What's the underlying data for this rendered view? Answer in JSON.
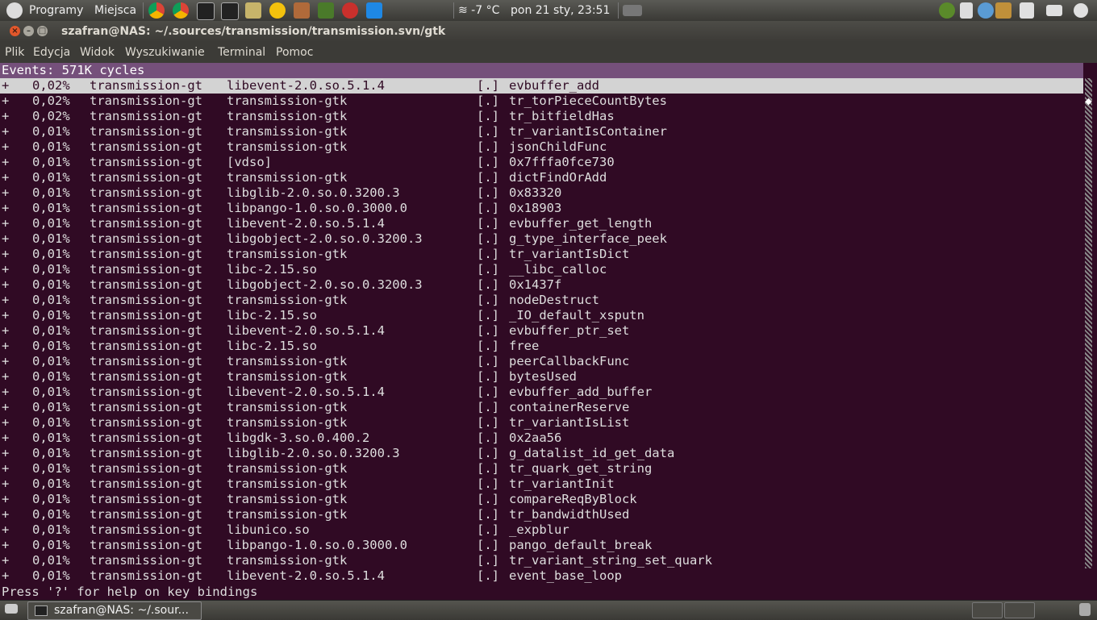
{
  "top_panel": {
    "apps_label": "Programy",
    "places_label": "Miejsca",
    "weather": "≋ -7 °C",
    "clock": "pon 21 sty, 23:51"
  },
  "window": {
    "title": "szafran@NAS: ~/.sources/transmission/transmission.svn/gtk"
  },
  "menu": [
    "Plik",
    "Edycja",
    "Widok",
    "Wyszukiwanie",
    "Terminal",
    "Pomoc"
  ],
  "terminal": {
    "events_header": "Events: 571K cycles",
    "rows": [
      {
        "mark": "+",
        "pct": "0,02%",
        "cmd": "transmission-gt",
        "obj": "libevent-2.0.so.5.1.4",
        "lvl": "[.]",
        "sym": "evbuffer_add"
      },
      {
        "mark": "+",
        "pct": "0,02%",
        "cmd": "transmission-gt",
        "obj": "transmission-gtk",
        "lvl": "[.]",
        "sym": "tr_torPieceCountBytes"
      },
      {
        "mark": "+",
        "pct": "0,02%",
        "cmd": "transmission-gt",
        "obj": "transmission-gtk",
        "lvl": "[.]",
        "sym": "tr_bitfieldHas"
      },
      {
        "mark": "+",
        "pct": "0,01%",
        "cmd": "transmission-gt",
        "obj": "transmission-gtk",
        "lvl": "[.]",
        "sym": "tr_variantIsContainer"
      },
      {
        "mark": "+",
        "pct": "0,01%",
        "cmd": "transmission-gt",
        "obj": "transmission-gtk",
        "lvl": "[.]",
        "sym": "jsonChildFunc"
      },
      {
        "mark": "+",
        "pct": "0,01%",
        "cmd": "transmission-gt",
        "obj": "[vdso]",
        "lvl": "[.]",
        "sym": "0x7fffa0fce730"
      },
      {
        "mark": "+",
        "pct": "0,01%",
        "cmd": "transmission-gt",
        "obj": "transmission-gtk",
        "lvl": "[.]",
        "sym": "dictFindOrAdd"
      },
      {
        "mark": "+",
        "pct": "0,01%",
        "cmd": "transmission-gt",
        "obj": "libglib-2.0.so.0.3200.3",
        "lvl": "[.]",
        "sym": "0x83320"
      },
      {
        "mark": "+",
        "pct": "0,01%",
        "cmd": "transmission-gt",
        "obj": "libpango-1.0.so.0.3000.0",
        "lvl": "[.]",
        "sym": "0x18903"
      },
      {
        "mark": "+",
        "pct": "0,01%",
        "cmd": "transmission-gt",
        "obj": "libevent-2.0.so.5.1.4",
        "lvl": "[.]",
        "sym": "evbuffer_get_length"
      },
      {
        "mark": "+",
        "pct": "0,01%",
        "cmd": "transmission-gt",
        "obj": "libgobject-2.0.so.0.3200.3",
        "lvl": "[.]",
        "sym": "g_type_interface_peek"
      },
      {
        "mark": "+",
        "pct": "0,01%",
        "cmd": "transmission-gt",
        "obj": "transmission-gtk",
        "lvl": "[.]",
        "sym": "tr_variantIsDict"
      },
      {
        "mark": "+",
        "pct": "0,01%",
        "cmd": "transmission-gt",
        "obj": "libc-2.15.so",
        "lvl": "[.]",
        "sym": "__libc_calloc"
      },
      {
        "mark": "+",
        "pct": "0,01%",
        "cmd": "transmission-gt",
        "obj": "libgobject-2.0.so.0.3200.3",
        "lvl": "[.]",
        "sym": "0x1437f"
      },
      {
        "mark": "+",
        "pct": "0,01%",
        "cmd": "transmission-gt",
        "obj": "transmission-gtk",
        "lvl": "[.]",
        "sym": "nodeDestruct"
      },
      {
        "mark": "+",
        "pct": "0,01%",
        "cmd": "transmission-gt",
        "obj": "libc-2.15.so",
        "lvl": "[.]",
        "sym": "_IO_default_xsputn"
      },
      {
        "mark": "+",
        "pct": "0,01%",
        "cmd": "transmission-gt",
        "obj": "libevent-2.0.so.5.1.4",
        "lvl": "[.]",
        "sym": "evbuffer_ptr_set"
      },
      {
        "mark": "+",
        "pct": "0,01%",
        "cmd": "transmission-gt",
        "obj": "libc-2.15.so",
        "lvl": "[.]",
        "sym": "free"
      },
      {
        "mark": "+",
        "pct": "0,01%",
        "cmd": "transmission-gt",
        "obj": "transmission-gtk",
        "lvl": "[.]",
        "sym": "peerCallbackFunc"
      },
      {
        "mark": "+",
        "pct": "0,01%",
        "cmd": "transmission-gt",
        "obj": "transmission-gtk",
        "lvl": "[.]",
        "sym": "bytesUsed"
      },
      {
        "mark": "+",
        "pct": "0,01%",
        "cmd": "transmission-gt",
        "obj": "libevent-2.0.so.5.1.4",
        "lvl": "[.]",
        "sym": "evbuffer_add_buffer"
      },
      {
        "mark": "+",
        "pct": "0,01%",
        "cmd": "transmission-gt",
        "obj": "transmission-gtk",
        "lvl": "[.]",
        "sym": "containerReserve"
      },
      {
        "mark": "+",
        "pct": "0,01%",
        "cmd": "transmission-gt",
        "obj": "transmission-gtk",
        "lvl": "[.]",
        "sym": "tr_variantIsList"
      },
      {
        "mark": "+",
        "pct": "0,01%",
        "cmd": "transmission-gt",
        "obj": "libgdk-3.so.0.400.2",
        "lvl": "[.]",
        "sym": "0x2aa56"
      },
      {
        "mark": "+",
        "pct": "0,01%",
        "cmd": "transmission-gt",
        "obj": "libglib-2.0.so.0.3200.3",
        "lvl": "[.]",
        "sym": "g_datalist_id_get_data"
      },
      {
        "mark": "+",
        "pct": "0,01%",
        "cmd": "transmission-gt",
        "obj": "transmission-gtk",
        "lvl": "[.]",
        "sym": "tr_quark_get_string"
      },
      {
        "mark": "+",
        "pct": "0,01%",
        "cmd": "transmission-gt",
        "obj": "transmission-gtk",
        "lvl": "[.]",
        "sym": "tr_variantInit"
      },
      {
        "mark": "+",
        "pct": "0,01%",
        "cmd": "transmission-gt",
        "obj": "transmission-gtk",
        "lvl": "[.]",
        "sym": "compareReqByBlock"
      },
      {
        "mark": "+",
        "pct": "0,01%",
        "cmd": "transmission-gt",
        "obj": "transmission-gtk",
        "lvl": "[.]",
        "sym": "tr_bandwidthUsed"
      },
      {
        "mark": "+",
        "pct": "0,01%",
        "cmd": "transmission-gt",
        "obj": "libunico.so",
        "lvl": "[.]",
        "sym": "_expblur"
      },
      {
        "mark": "+",
        "pct": "0,01%",
        "cmd": "transmission-gt",
        "obj": "libpango-1.0.so.0.3000.0",
        "lvl": "[.]",
        "sym": "pango_default_break"
      },
      {
        "mark": "+",
        "pct": "0,01%",
        "cmd": "transmission-gt",
        "obj": "transmission-gtk",
        "lvl": "[.]",
        "sym": "tr_variant_string_set_quark"
      },
      {
        "mark": "+",
        "pct": "0,01%",
        "cmd": "transmission-gt",
        "obj": "libevent-2.0.so.5.1.4",
        "lvl": "[.]",
        "sym": "event_base_loop"
      }
    ],
    "status_line": "Press '?' for help on key bindings"
  },
  "taskbar": {
    "task_label": "szafran@NAS: ~/.sour..."
  },
  "colors": {
    "terminal_bg": "#300a24",
    "header_bg": "#75507b",
    "selected_row_bg": "#d3d3d3"
  }
}
